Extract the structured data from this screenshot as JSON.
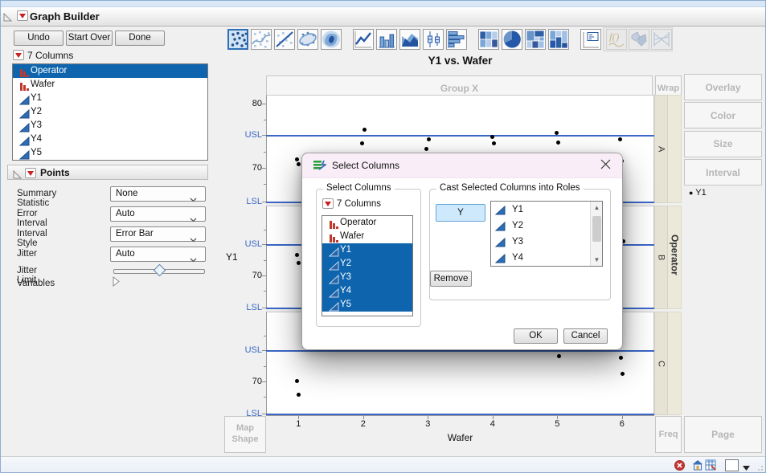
{
  "colors": {
    "selection_blue": "#0e65ae",
    "spec_line_blue": "#3a67c8",
    "nominal_red": "#c0392b",
    "continuous_blue": "#2e6db4",
    "dialog_title_pink": "#f9eef7",
    "toolbar_selected_border": "#2f6fb5"
  },
  "titlebar": {
    "title": "Graph Builder"
  },
  "action_buttons": {
    "undo": "Undo",
    "start_over": "Start Over",
    "done": "Done"
  },
  "columns_panel": {
    "header": "7 Columns",
    "items": [
      {
        "name": "Operator",
        "type": "nominal",
        "selected": true
      },
      {
        "name": "Wafer",
        "type": "nominal",
        "selected": false
      },
      {
        "name": "Y1",
        "type": "continuous",
        "selected": false
      },
      {
        "name": "Y2",
        "type": "continuous",
        "selected": false
      },
      {
        "name": "Y3",
        "type": "continuous",
        "selected": false
      },
      {
        "name": "Y4",
        "type": "continuous",
        "selected": false
      },
      {
        "name": "Y5",
        "type": "continuous",
        "selected": false
      }
    ]
  },
  "points_panel": {
    "header": "Points",
    "rows": [
      {
        "label": "Summary Statistic",
        "value": "None",
        "type": "dropdown"
      },
      {
        "label": "Error Interval",
        "value": "Auto",
        "type": "dropdown"
      },
      {
        "label": "Interval Style",
        "value": "Error Bar",
        "type": "dropdown"
      },
      {
        "label": "Jitter",
        "value": "Auto",
        "type": "dropdown"
      },
      {
        "label": "Jitter Limit",
        "type": "slider",
        "position": 0.5
      },
      {
        "label": "Variables",
        "type": "disclosure"
      }
    ]
  },
  "toolbar": {
    "icons": [
      {
        "name": "points-scatter",
        "selected": true
      },
      {
        "name": "smoother"
      },
      {
        "name": "line-of-fit"
      },
      {
        "name": "ellipse"
      },
      {
        "name": "contour"
      },
      {
        "name": "line-chart"
      },
      {
        "name": "bar-chart"
      },
      {
        "name": "area-chart"
      },
      {
        "name": "box-plot"
      },
      {
        "name": "histogram"
      },
      {
        "name": "heatmap"
      },
      {
        "name": "pie-chart"
      },
      {
        "name": "treemap"
      },
      {
        "name": "mosaic"
      },
      {
        "name": "caption-box"
      },
      {
        "name": "formula",
        "disabled": true
      },
      {
        "name": "map-shape",
        "disabled": true
      },
      {
        "name": "parallel-plot",
        "disabled": true
      }
    ]
  },
  "chart": {
    "title": "Y1 vs. Wafer",
    "group_x_label": "Group X",
    "wrap_label": "Wrap",
    "drop_zones": [
      "Overlay",
      "Color",
      "Size",
      "Interval"
    ],
    "legend_item": "Y1",
    "y_axis_label": "Y1",
    "x_axis_label": "Wafer",
    "x_ticks": [
      "1",
      "2",
      "3",
      "4",
      "5",
      "6"
    ],
    "group_strip_label": "Operator",
    "panel_labels": [
      "A",
      "B",
      "C"
    ],
    "spec_labels": {
      "upper": "USL",
      "lower": "LSL"
    },
    "y_tick_labels": {
      "top": "80",
      "middle": "70"
    },
    "map_shape_label_line1": "Map",
    "map_shape_label_line2": "Shape",
    "freq_label": "Freq",
    "page_label": "Page",
    "points": {
      "A": [
        [
          1,
          71.3
        ],
        [
          1,
          70.6
        ],
        [
          2,
          76.0
        ],
        [
          2,
          73.8
        ],
        [
          3,
          74.4
        ],
        [
          3,
          72.9
        ],
        [
          4,
          74.8
        ],
        [
          4,
          73.8
        ],
        [
          5,
          75.4
        ],
        [
          5,
          74.0
        ],
        [
          6,
          74.4
        ],
        [
          6,
          71.1
        ]
      ],
      "B": [
        [
          1,
          73.3
        ],
        [
          1,
          72.0
        ],
        [
          6,
          75.6
        ],
        [
          6,
          72.2
        ]
      ],
      "C": [
        [
          1,
          70.1
        ],
        [
          1,
          67.8
        ],
        [
          5,
          74.1
        ],
        [
          6,
          73.9
        ],
        [
          6,
          71.3
        ]
      ]
    }
  },
  "dialog": {
    "title": "Select Columns",
    "select_group": {
      "label": "Select Columns",
      "columns_header": "7 Columns",
      "items": [
        {
          "name": "Operator",
          "type": "nominal",
          "selected": false
        },
        {
          "name": "Wafer",
          "type": "nominal",
          "selected": false
        },
        {
          "name": "Y1",
          "type": "continuous",
          "selected": true
        },
        {
          "name": "Y2",
          "type": "continuous",
          "selected": true
        },
        {
          "name": "Y3",
          "type": "continuous",
          "selected": true
        },
        {
          "name": "Y4",
          "type": "continuous",
          "selected": true
        },
        {
          "name": "Y5",
          "type": "continuous",
          "selected": true
        }
      ]
    },
    "cast_group": {
      "label": "Cast Selected Columns into Roles",
      "role_button": "Y",
      "role_items": [
        "Y1",
        "Y2",
        "Y3",
        "Y4"
      ],
      "remove_button": "Remove"
    },
    "ok_button": "OK",
    "cancel_button": "Cancel"
  },
  "status_bar": {
    "icons": [
      "error-badge",
      "home-window",
      "data-table",
      "color-swatch",
      "swatch-arrow",
      "resize-grip"
    ]
  }
}
